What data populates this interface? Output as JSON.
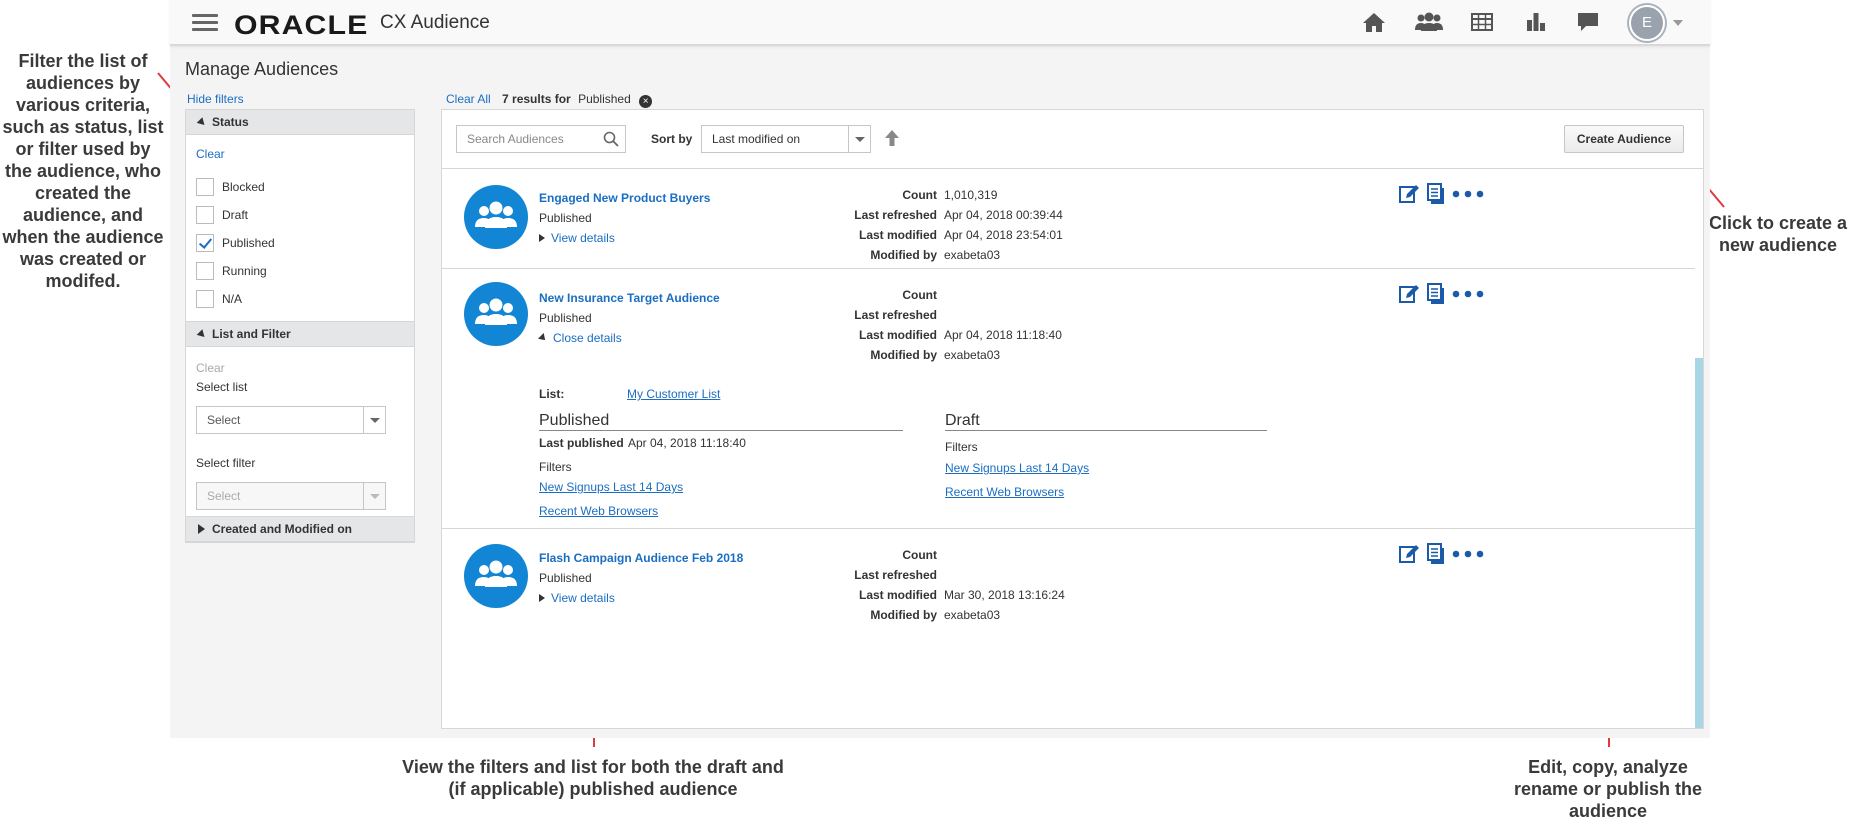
{
  "annotations": {
    "filter": "Filter the list of audiences by various criteria, such as status, list or filter used by the audience, who created the audience, and when the audience was created or modifed.",
    "create": "Click to create a new audience",
    "details": "View the filters and list for both the draft and (if applicable) published audience",
    "actions": "Edit, copy, analyze rename or publish the audience"
  },
  "header": {
    "logo": "ORACLE",
    "product": "CX Audience",
    "avatar_initial": "E",
    "icons": [
      "home-icon",
      "people-icon",
      "table-icon",
      "bar-chart-icon",
      "chat-icon"
    ]
  },
  "page": {
    "title": "Manage Audiences",
    "hide_filters": "Hide filters"
  },
  "filters": {
    "status": {
      "title": "Status",
      "clear": "Clear",
      "options": [
        {
          "label": "Blocked",
          "checked": false
        },
        {
          "label": "Draft",
          "checked": false
        },
        {
          "label": "Published",
          "checked": true
        },
        {
          "label": "Running",
          "checked": false
        },
        {
          "label": "N/A",
          "checked": false
        }
      ]
    },
    "list_filter": {
      "title": "List and Filter",
      "clear": "Clear",
      "select_list_label": "Select list",
      "select_list_value": "Select",
      "select_filter_label": "Select filter",
      "select_filter_value": "Select"
    },
    "created": {
      "title": "Created and Modified on"
    }
  },
  "results": {
    "clear_all": "Clear All",
    "count_text": "7 results for",
    "filter_chip": "Published",
    "search_placeholder": "Search Audiences",
    "sort_label": "Sort by",
    "sort_value": "Last modified on",
    "create_button": "Create Audience"
  },
  "meta_labels": {
    "count": "Count",
    "last_refreshed": "Last refreshed",
    "last_modified": "Last modified",
    "modified_by": "Modified by"
  },
  "audiences": [
    {
      "name": "Engaged New Product Buyers",
      "status": "Published",
      "toggle": "View details",
      "count": "1,010,319",
      "last_refreshed": "Apr 04, 2018 00:39:44",
      "last_modified": "Apr 04, 2018 23:54:01",
      "modified_by": "exabeta03"
    },
    {
      "name": "New Insurance Target Audience",
      "status": "Published",
      "toggle": "Close details",
      "count": "",
      "last_refreshed": "",
      "last_modified": "Apr 04, 2018 11:18:40",
      "modified_by": "exabeta03",
      "details": {
        "list_label": "List:",
        "list_value": "My Customer List",
        "published_title": "Published",
        "last_published_label": "Last published",
        "last_published_value": "Apr 04, 2018 11:18:40",
        "published_filters_label": "Filters",
        "published_filters": [
          "New Signups Last 14 Days",
          "Recent Web Browsers"
        ],
        "draft_title": "Draft",
        "draft_filters_label": "Filters",
        "draft_filters": [
          "New Signups Last 14 Days",
          "Recent Web Browsers"
        ]
      }
    },
    {
      "name": "Flash Campaign Audience Feb 2018",
      "status": "Published",
      "toggle": "View details",
      "count": "",
      "last_refreshed": "",
      "last_modified": "Mar 30, 2018 13:16:24",
      "modified_by": "exabeta03"
    }
  ],
  "colors": {
    "accent": "#1b6ec2",
    "avatar_circle": "#1285d4",
    "annotation_arrow": "#e0393e"
  }
}
